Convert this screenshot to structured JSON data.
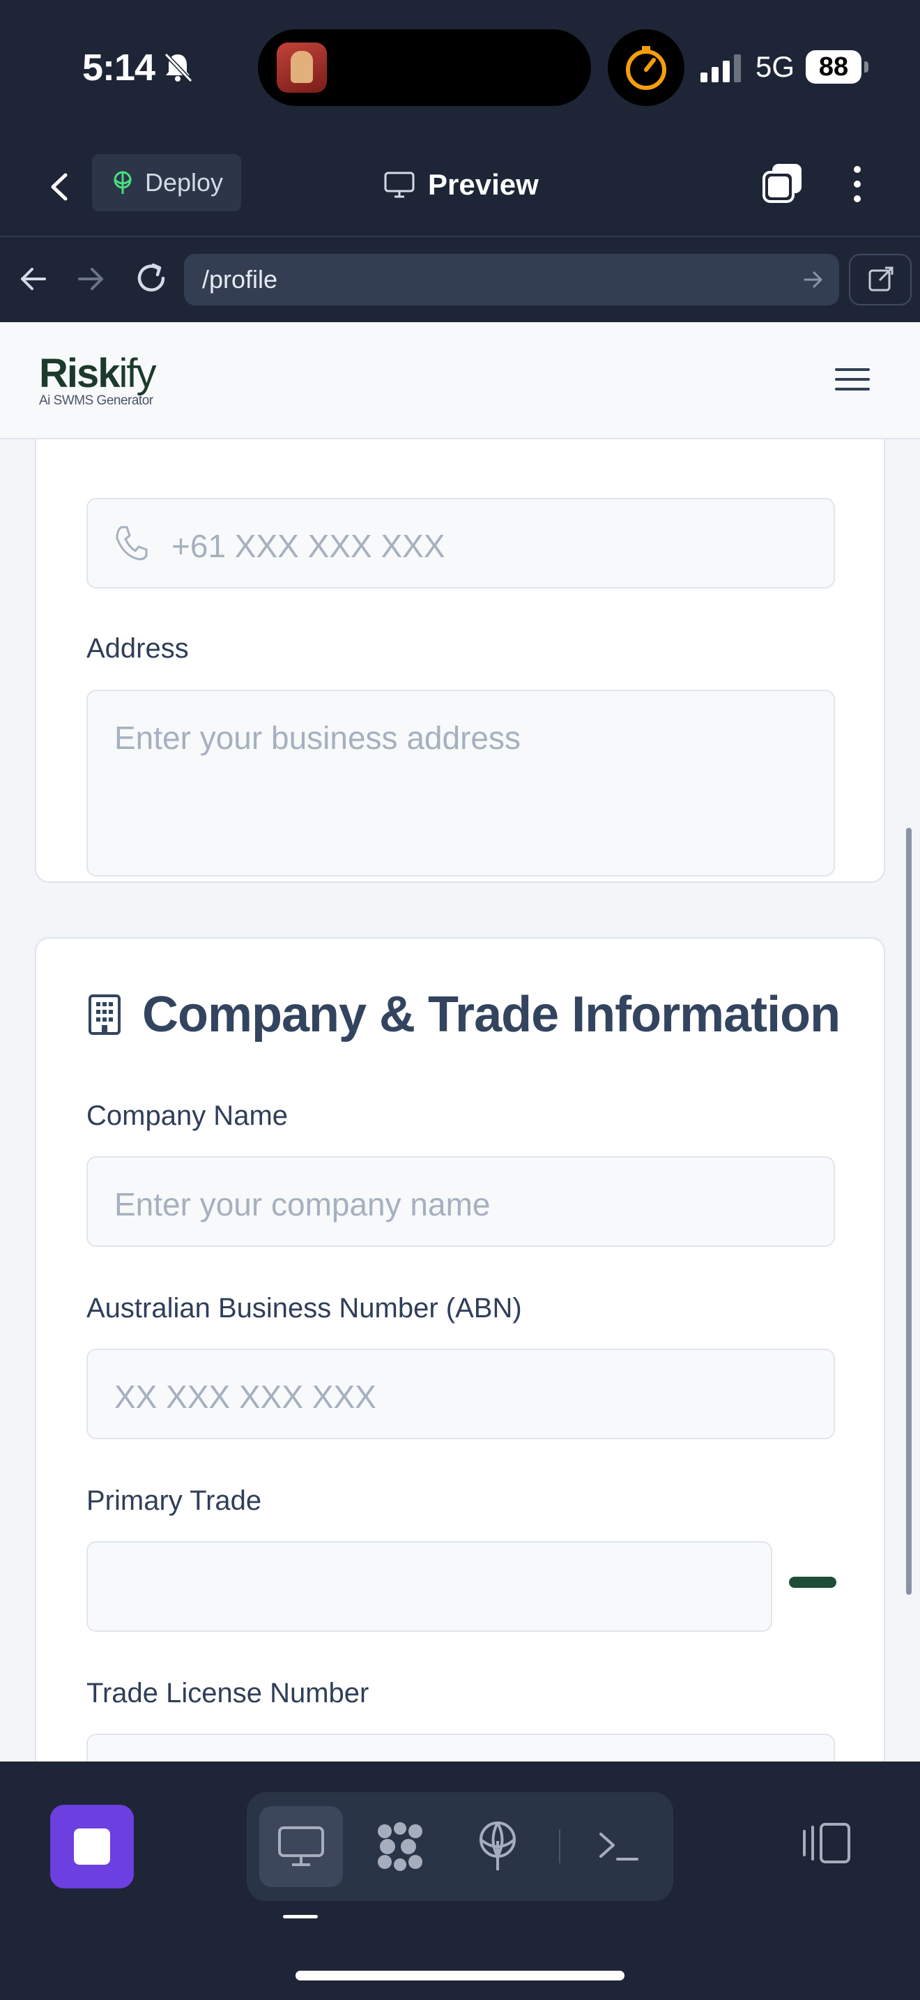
{
  "status_bar": {
    "time": "5:14",
    "network": "5G",
    "battery": "88"
  },
  "header": {
    "deploy_label": "Deploy",
    "title": "Preview"
  },
  "url_bar": {
    "url": "/profile"
  },
  "site": {
    "logo_text_bold": "Risk",
    "logo_text_thin": "ify",
    "logo_tagline": "Ai SWMS Generator"
  },
  "personal_card": {
    "phone_placeholder": "+61 XXX XXX XXX",
    "address_label": "Address",
    "address_placeholder": "Enter your business address"
  },
  "company_card": {
    "heading": "Company & Trade Information",
    "company_name_label": "Company Name",
    "company_name_placeholder": "Enter your company name",
    "abn_label": "Australian Business Number (ABN)",
    "abn_placeholder": "XX XXX XXX XXX",
    "primary_trade_label": "Primary Trade",
    "primary_trade_value": "",
    "license_label": "Trade License Number"
  },
  "bottom_bar": {
    "tabs": [
      "preview-icon",
      "apps-icon",
      "deploy-icon",
      "terminal-icon"
    ],
    "active_tab": "preview-icon"
  },
  "colors": {
    "accent": "#6b3fe0",
    "brand": "#1c3a2c",
    "chrome": "#1e2536"
  }
}
